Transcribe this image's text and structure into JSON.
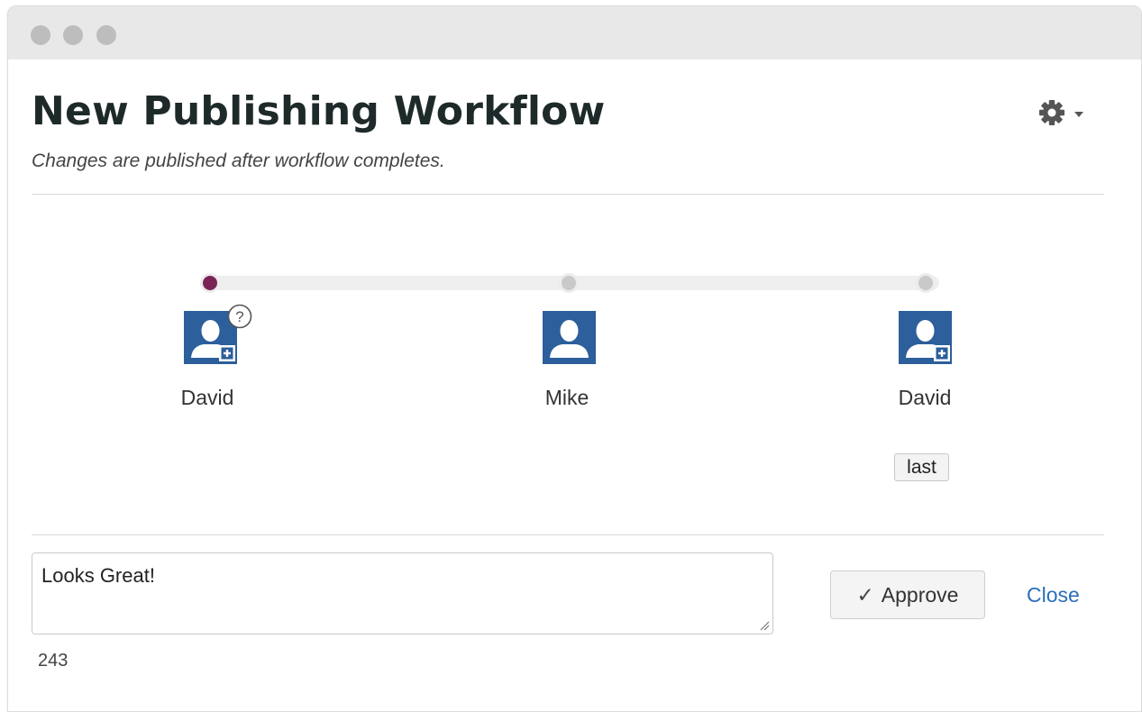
{
  "header": {
    "title": "New Publishing Workflow",
    "subtitle": "Changes are published after workflow completes.",
    "settings_icon": "gear-icon"
  },
  "colors": {
    "active_step": "#7b2557",
    "user_icon": "#2c5f9b",
    "link": "#2a6ebb"
  },
  "workflow": {
    "steps": [
      {
        "name": "David",
        "active": true,
        "icon": "user-add-icon",
        "help_icon": "question-circle-icon"
      },
      {
        "name": "Mike",
        "active": false,
        "icon": "user-icon"
      },
      {
        "name": "David",
        "active": false,
        "icon": "user-add-icon",
        "badge": "last"
      }
    ]
  },
  "comment": {
    "value": "Looks Great!",
    "char_count": "243"
  },
  "actions": {
    "approve_check": "✓",
    "approve_label": "Approve",
    "close_label": "Close"
  }
}
